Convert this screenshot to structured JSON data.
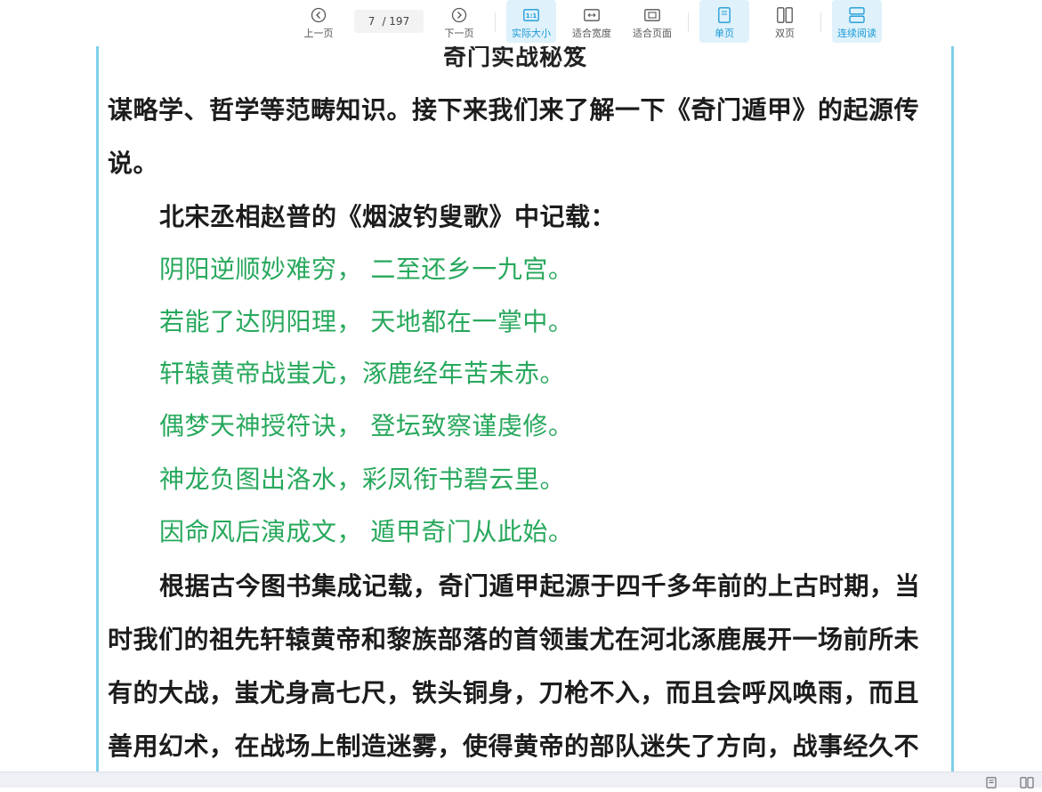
{
  "toolbar": {
    "prev_label": "上一页",
    "next_label": "下一页",
    "current_page": "7",
    "total_pages": "/ 197",
    "actual_size_label": "实际大小",
    "fit_width_label": "适合宽度",
    "fit_page_label": "适合页面",
    "single_page_label": "单页",
    "double_page_label": "双页",
    "continuous_label": "连续阅读",
    "actual_size_icon_text": "1:1"
  },
  "colors": {
    "accent": "#1a9ad6",
    "active_bg": "#dff1fb",
    "page_border": "#7fd0ea",
    "poem_green": "#27a85c"
  },
  "document": {
    "header_title": "奇门实战秘笈",
    "lines": [
      "谋略学、哲学等范畴知识。接下来我们来了解一下《奇门遁甲》的起源传",
      "说。",
      "北宋丞相赵普的《烟波钓叟歌》中记载：",
      "阴阳逆顺妙难穷，  二至还乡一九宫。",
      "若能了达阴阳理，  天地都在一掌中。",
      "轩辕黄帝战蚩尤，涿鹿经年苦未赤。",
      "偶梦天神授符诀，  登坛致察谨虔修。",
      "神龙负图出洛水，彩凤衔书碧云里。",
      "因命风后演成文，  遁甲奇门从此始。",
      "根据古今图书集成记载，奇门遁甲起源于四千多年前的上古时期，当",
      "时我们的祖先轩辕黄帝和黎族部落的首领蚩尤在河北涿鹿展开一场前所未",
      "有的大战，蚩尤身高七尺，铁头铜身，刀枪不入，而且会呼风唤雨，而且",
      "善用幻术，在战场上制造迷雾，使得黄帝的部队迷失了方向，战事经久不"
    ]
  }
}
